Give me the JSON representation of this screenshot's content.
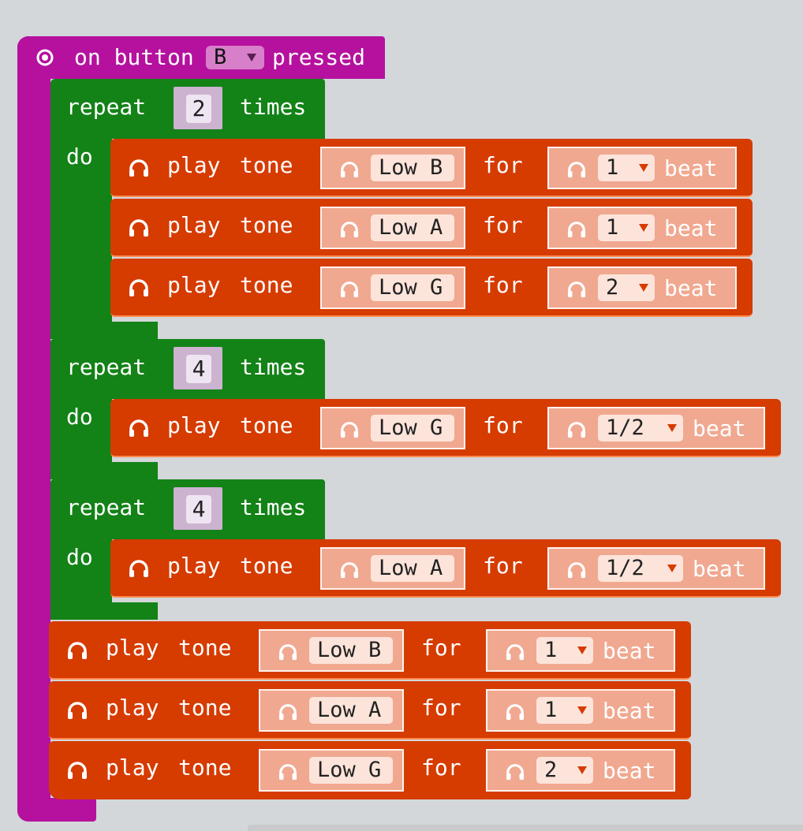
{
  "event_block": {
    "prefix": "on button",
    "button_value": "B",
    "suffix": "pressed"
  },
  "repeat_label": "repeat",
  "times_label": "times",
  "do_label": "do",
  "tone_word_play": "play",
  "tone_word_tone": "tone",
  "for_label": "for",
  "beat_label": "beat",
  "repeats": [
    {
      "count": "2",
      "tones": [
        {
          "note": "Low B",
          "beats": "1"
        },
        {
          "note": "Low A",
          "beats": "1"
        },
        {
          "note": "Low G",
          "beats": "2"
        }
      ]
    },
    {
      "count": "4",
      "tones": [
        {
          "note": "Low G",
          "beats": "1/2"
        }
      ]
    },
    {
      "count": "4",
      "tones": [
        {
          "note": "Low A",
          "beats": "1/2"
        }
      ]
    }
  ],
  "tail_tones": [
    {
      "note": "Low B",
      "beats": "1"
    },
    {
      "note": "Low A",
      "beats": "1"
    },
    {
      "note": "Low G",
      "beats": "2"
    }
  ],
  "colors": {
    "event": "#b5119e",
    "loop": "#138217",
    "music": "#d63b00",
    "workspace": "#e9ecee"
  },
  "icons": {
    "event": "target-icon",
    "music": "headphones-icon",
    "dropdown": "dropdown-triangle-icon"
  }
}
